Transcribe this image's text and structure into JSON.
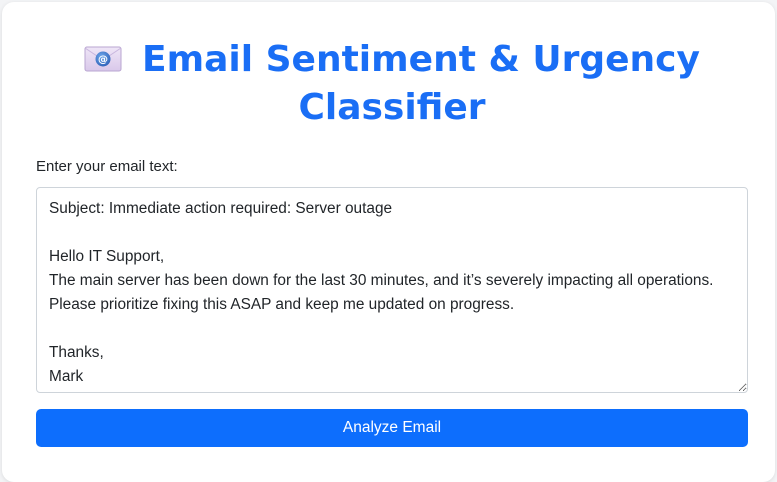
{
  "header": {
    "icon": "email-envelope-icon",
    "title": "Email Sentiment & Urgency Classifier"
  },
  "form": {
    "label": "Enter your email text:",
    "email_text": "Subject: Immediate action required: Server outage\n\nHello IT Support,\nThe main server has been down for the last 30 minutes, and it’s severely impacting all operations.\nPlease prioritize fixing this ASAP and keep me updated on progress.\n\nThanks,\nMark",
    "submit_label": "Analyze Email"
  },
  "colors": {
    "accent": "#1a6ef5",
    "button": "#0d6efd",
    "background": "#f3f4f6",
    "card": "#ffffff"
  }
}
